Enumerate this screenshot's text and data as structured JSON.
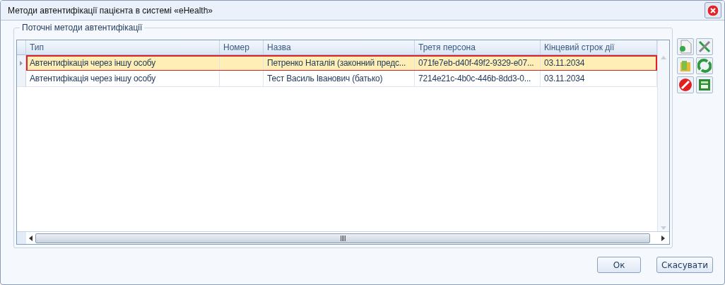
{
  "window": {
    "title": "Методи автентифікації пацієнта в системі «eHealth»"
  },
  "group": {
    "title": "Поточні методи автентифікації"
  },
  "table": {
    "columns": [
      "Тип",
      "Номер",
      "Назва",
      "Третя персона",
      "Кінцевий строк дії"
    ],
    "rows": [
      {
        "cells": [
          "Автентифікація через іншу особу",
          "",
          "Петренко Наталія (законний предс...",
          "071fe7eb-d40f-49f2-9329-e07...",
          "03.11.2034"
        ],
        "selected": true
      },
      {
        "cells": [
          "Автентифікація через іншу особу",
          "",
          "Тест Василь Іванович (батько)",
          "7214e21c-4b0c-446b-8dd3-0...",
          "03.11.2034"
        ],
        "selected": false
      }
    ]
  },
  "tools": [
    {
      "kind": "document"
    },
    {
      "kind": "tools"
    },
    {
      "kind": "folder"
    },
    {
      "kind": "refresh"
    },
    {
      "kind": "cancel"
    },
    {
      "kind": "sheet"
    }
  ],
  "buttons": [
    "Ок",
    "Скасувати"
  ]
}
